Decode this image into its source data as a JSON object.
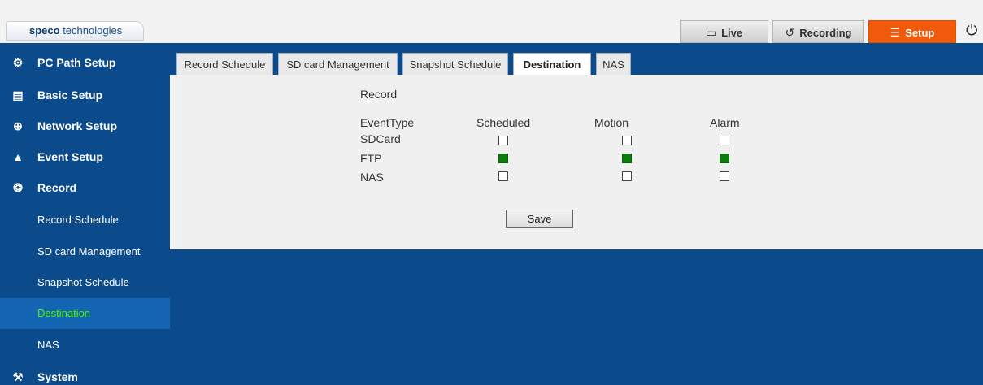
{
  "header": {
    "logo_brand": "speco",
    "logo_rest": " technologies",
    "buttons": {
      "live": "Live",
      "recording": "Recording",
      "setup": "Setup"
    }
  },
  "sidebar": {
    "items": [
      {
        "label": "PC Path Setup",
        "icon": "gear-icon"
      },
      {
        "label": "Basic Setup",
        "icon": "clapperboard-icon"
      },
      {
        "label": "Network Setup",
        "icon": "network-icon"
      },
      {
        "label": "Event Setup",
        "icon": "bell-icon"
      },
      {
        "label": "Record",
        "icon": "film-reel-icon"
      }
    ],
    "record_sub": [
      "Record Schedule",
      "SD card Management",
      "Snapshot Schedule",
      "Destination",
      "NAS"
    ],
    "active_sub": "Destination",
    "system_label": "System",
    "accent_color": "#4ef000"
  },
  "tabs": [
    "Record Schedule",
    "SD card Management",
    "Snapshot Schedule",
    "Destination",
    "NAS"
  ],
  "active_tab": "Destination",
  "form": {
    "section_title": "Record",
    "headers": [
      "EventType",
      "Scheduled",
      "Motion",
      "Alarm"
    ],
    "rows": [
      {
        "label": "SDCard",
        "scheduled": false,
        "motion": false,
        "alarm": false
      },
      {
        "label": "FTP",
        "scheduled": true,
        "motion": true,
        "alarm": true
      },
      {
        "label": "NAS",
        "scheduled": false,
        "motion": false,
        "alarm": false
      }
    ],
    "save_label": "Save"
  },
  "colors": {
    "navy": "#0b4a8b",
    "setup_orange": "#f05a0a",
    "checked_green": "#0b7d0b"
  }
}
